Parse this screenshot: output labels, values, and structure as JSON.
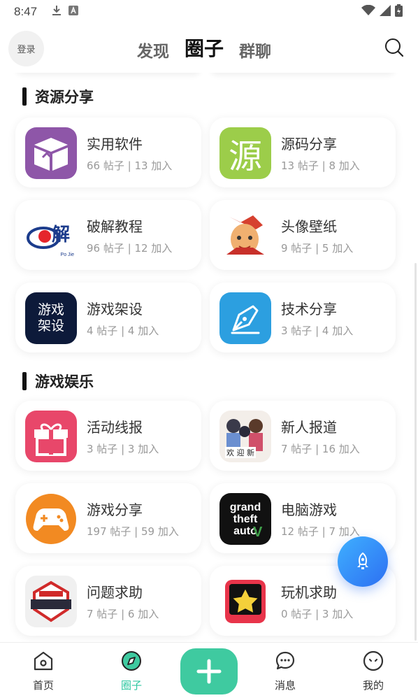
{
  "status_bar": {
    "time": "8:47"
  },
  "header": {
    "login_label": "登录",
    "tabs": [
      {
        "label": "发现",
        "active": false
      },
      {
        "label": "圈子",
        "active": true
      },
      {
        "label": "群聊",
        "active": false
      }
    ]
  },
  "sections": [
    {
      "title": "资源分享",
      "cards": [
        {
          "name": "实用软件",
          "meta": "66 帖子 | 13 加入",
          "icon": "box-icon"
        },
        {
          "name": "源码分享",
          "meta": "13 帖子 | 8 加入",
          "icon": "source-char-icon",
          "icon_text": "源"
        },
        {
          "name": "破解教程",
          "meta": "96 帖子 | 12 加入",
          "icon": "crack-logo-icon",
          "icon_text": "解",
          "icon_subtext": "Po Jie"
        },
        {
          "name": "头像壁纸",
          "meta": "9 帖子 | 5 加入",
          "icon": "avatar-illustration-icon"
        },
        {
          "name": "游戏架设",
          "meta": "4 帖子 | 4 加入",
          "icon": "game-setup-icon",
          "icon_text": "游戏架设"
        },
        {
          "name": "技术分享",
          "meta": "3 帖子 | 4 加入",
          "icon": "pen-nib-icon"
        }
      ]
    },
    {
      "title": "游戏娱乐",
      "cards": [
        {
          "name": "活动线报",
          "meta": "3 帖子 | 3 加入",
          "icon": "gift-icon"
        },
        {
          "name": "新人报道",
          "meta": "7 帖子 | 16 加入",
          "icon": "welcome-anime-icon",
          "icon_text": "欢 迎 新"
        },
        {
          "name": "游戏分享",
          "meta": "197 帖子 | 59 加入",
          "icon": "gamepad-icon"
        },
        {
          "name": "电脑游戏",
          "meta": "12 帖子 | 7 加入",
          "icon": "gta-logo-icon",
          "icon_text": "grand theft auto"
        },
        {
          "name": "问题求助",
          "meta": "7 帖子 | 6 加入",
          "icon": "help-badge-icon"
        },
        {
          "name": "玩机求助",
          "meta": "0 帖子 | 3 加入",
          "icon": "star-badge-icon"
        }
      ]
    }
  ],
  "bottom_nav": {
    "items": [
      {
        "label": "首页",
        "icon": "home-icon",
        "active": false
      },
      {
        "label": "圈子",
        "icon": "compass-icon",
        "active": true
      },
      {
        "label": "消息",
        "icon": "chat-icon",
        "active": false
      },
      {
        "label": "我的",
        "icon": "profile-face-icon",
        "active": false
      }
    ]
  },
  "colors": {
    "accent": "#3fcaa0",
    "fab_start": "#3fb0ff",
    "fab_end": "#2d6ff2"
  }
}
